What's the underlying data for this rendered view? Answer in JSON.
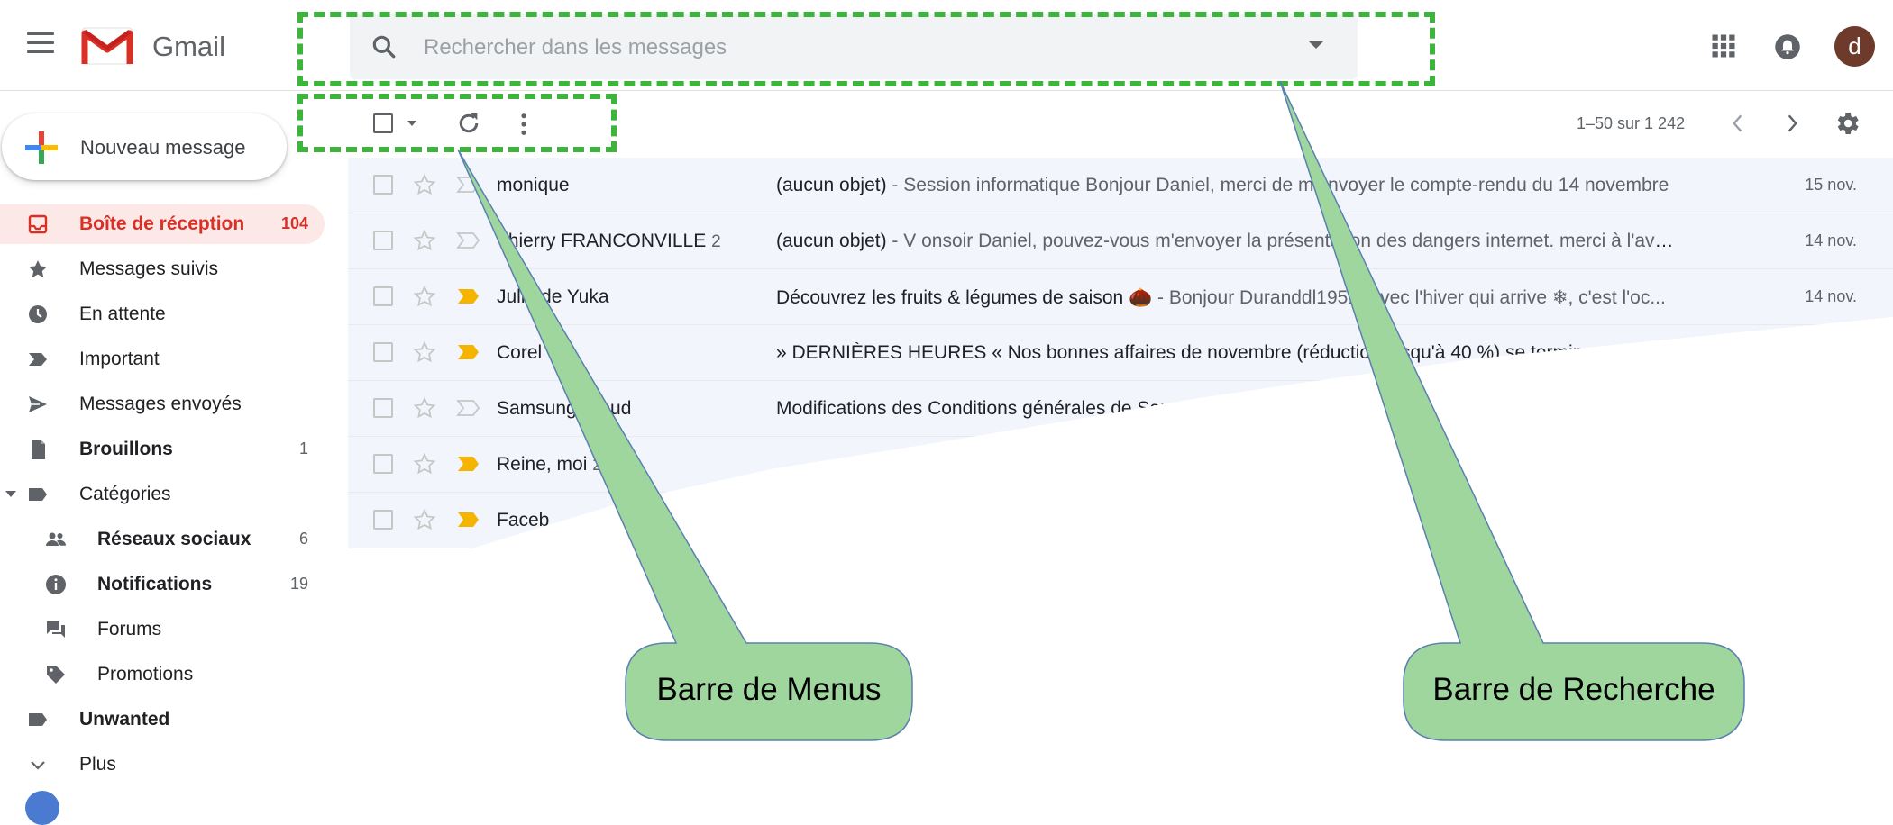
{
  "header": {
    "app_title": "Gmail",
    "search_placeholder": "Rechercher dans les messages",
    "avatar_letter": "d",
    "icons": [
      "menu-icon",
      "gmail-logo",
      "search-icon",
      "apps-icon",
      "notifications-icon"
    ]
  },
  "compose": {
    "label": "Nouveau message"
  },
  "sidebar": {
    "items": [
      {
        "label": "Boîte de réception",
        "count": "104",
        "icon": "inbox-icon"
      },
      {
        "label": "Messages suivis",
        "count": "",
        "icon": "star-icon"
      },
      {
        "label": "En attente",
        "count": "",
        "icon": "clock-icon"
      },
      {
        "label": "Important",
        "count": "",
        "icon": "important-icon"
      },
      {
        "label": "Messages envoyés",
        "count": "",
        "icon": "send-icon"
      },
      {
        "label": "Brouillons",
        "count": "1",
        "icon": "draft-icon"
      },
      {
        "label": "Catégories",
        "count": "",
        "icon": "label-icon"
      },
      {
        "label": "Réseaux sociaux",
        "count": "6",
        "icon": "people-icon"
      },
      {
        "label": "Notifications",
        "count": "19",
        "icon": "info-icon"
      },
      {
        "label": "Forums",
        "count": "",
        "icon": "forum-icon"
      },
      {
        "label": "Promotions",
        "count": "",
        "icon": "tag-icon"
      },
      {
        "label": "Unwanted",
        "count": "",
        "icon": "label-icon"
      },
      {
        "label": "Plus",
        "count": "",
        "icon": "chevron-down-icon"
      }
    ]
  },
  "toolbar": {
    "pagination": "1–50 sur 1 242"
  },
  "emails": [
    {
      "sender": "monique",
      "count": "",
      "subject": "(aucun objet)",
      "snippet": " - Session informatique Bonjour Daniel, merci de m'envoyer le compte-rendu du 14 novembre",
      "date": "15 nov.",
      "important": false
    },
    {
      "sender": "Thierry FRANCONVILLE",
      "count": "2",
      "subject": "(aucun objet)",
      "snippet": " - V onsoir Daniel, pouvez-vous m'envoyer la présentation des dangers internet. merci à l'ava...",
      "date": "14 nov.",
      "important": false
    },
    {
      "sender": "Julie de Yuka",
      "count": "",
      "subject": "Découvrez les fruits & légumes de saison 🌰",
      "snippet": " - Bonjour Duranddl1951, Avec l'hiver qui arrive ❄, c'est l'oc...",
      "date": "14 nov.",
      "important": true
    },
    {
      "sender": "Corel",
      "count": "",
      "subject": "» DERNIÈRES HEURES « Nos bonnes affaires de novembre (réduction jusqu'à 40 %) se terminent ce soir !",
      "snippet": "",
      "date": "",
      "important": true
    },
    {
      "sender": "Samsung Cloud",
      "count": "",
      "subject": "Modifications des Conditions générales de Sams",
      "snippet": "",
      "date": "",
      "important": false
    },
    {
      "sender": "Reine, moi",
      "count": "2",
      "subject": "",
      "snippet": "",
      "date": "",
      "important": true
    },
    {
      "sender": "Faceb",
      "count": "",
      "subject": "",
      "snippet": "",
      "date": "",
      "important": true
    }
  ],
  "annotations": {
    "menu_label": "Barre de Menus",
    "search_label": "Barre de Recherche",
    "color": "#3db53d",
    "callout_fill": "#9ed69e"
  },
  "colors": {
    "accent_red": "#d93025",
    "active_bg": "#fce8e6",
    "important_yellow": "#f4b400",
    "avatar_brown": "#6d3a2c"
  }
}
